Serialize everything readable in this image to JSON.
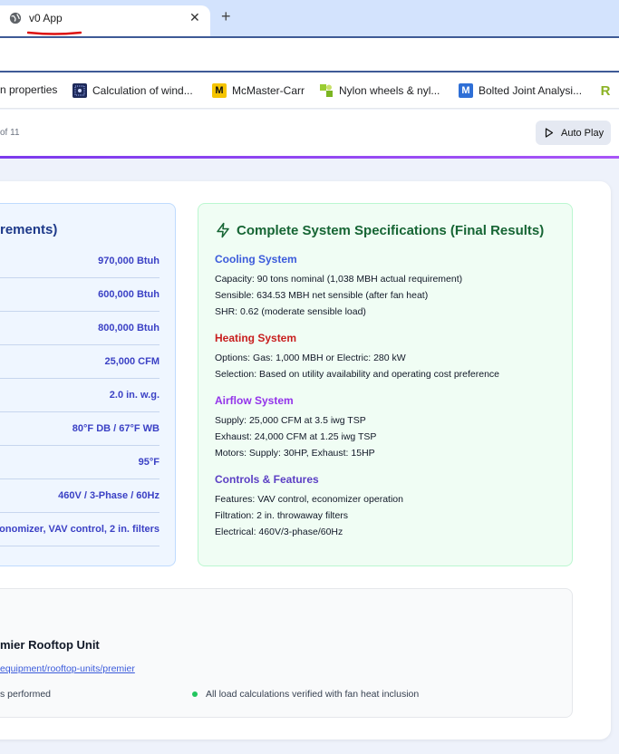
{
  "browser": {
    "tab_title": "v0 App",
    "close_glyph": "✕",
    "new_tab_glyph": "+",
    "bookmarks": [
      {
        "label": "n properties",
        "icon": ""
      },
      {
        "label": "Calculation of wind...",
        "icon": "wind-calc-icon"
      },
      {
        "label": "McMaster-Carr",
        "icon": "mcmaster-icon",
        "icon_text": "M"
      },
      {
        "label": "Nylon wheels & nyl...",
        "icon": "nylon-wheels-icon"
      },
      {
        "label": "Bolted Joint Analysi...",
        "icon": "bolted-joint-icon",
        "icon_text": "M"
      },
      {
        "label": "",
        "icon": "r-icon",
        "icon_text": "R"
      }
    ]
  },
  "header": {
    "step_text": "of 11",
    "autoplay_label": "Auto Play"
  },
  "requirements": {
    "title": "rements)",
    "values": [
      "970,000 Btuh",
      "600,000 Btuh",
      "800,000 Btuh",
      "25,000 CFM",
      "2.0 in. w.g.",
      "80°F DB / 67°F WB",
      "95°F",
      "460V / 3-Phase / 60Hz",
      "onomizer, VAV control, 2 in. filters"
    ]
  },
  "specs": {
    "title": "Complete System Specifications (Final Results)",
    "cooling": {
      "heading": "Cooling System",
      "lines": [
        "Capacity: 90 tons nominal (1,038 MBH actual requirement)",
        "Sensible: 634.53 MBH net sensible (after fan heat)",
        "SHR: 0.62 (moderate sensible load)"
      ]
    },
    "heating": {
      "heading": "Heating System",
      "lines": [
        "Options: Gas: 1,000 MBH or Electric: 280 kW",
        "Selection: Based on utility availability and operating cost preference"
      ]
    },
    "airflow": {
      "heading": "Airflow System",
      "lines": [
        "Supply: 25,000 CFM at 3.5 iwg TSP",
        "Exhaust: 24,000 CFM at 1.25 iwg TSP",
        "Motors: Supply: 30HP, Exhaust: 15HP"
      ]
    },
    "controls": {
      "heading": "Controls & Features",
      "lines": [
        "Features: VAV control, economizer operation",
        "Filtration: 2 in. throwaway filters",
        "Electrical: 460V/3-phase/60Hz"
      ]
    }
  },
  "selection": {
    "unit_title": "mier Rooftop Unit",
    "link_text": "equipment/rooftop-units/premier",
    "note_left": "s performed",
    "note_right": "All load calculations verified with fan heat inclusion"
  },
  "colors": {
    "tab_strip": "#d3e3fd",
    "accent_purple": "#7c3aed",
    "req_value": "#3b41c5",
    "spec_title": "#166534",
    "cooling": "#3b5bdb",
    "heating": "#c81e1e",
    "airflow": "#9333ea",
    "controls": "#5b3fc4",
    "verified_dot": "#22c55e"
  }
}
